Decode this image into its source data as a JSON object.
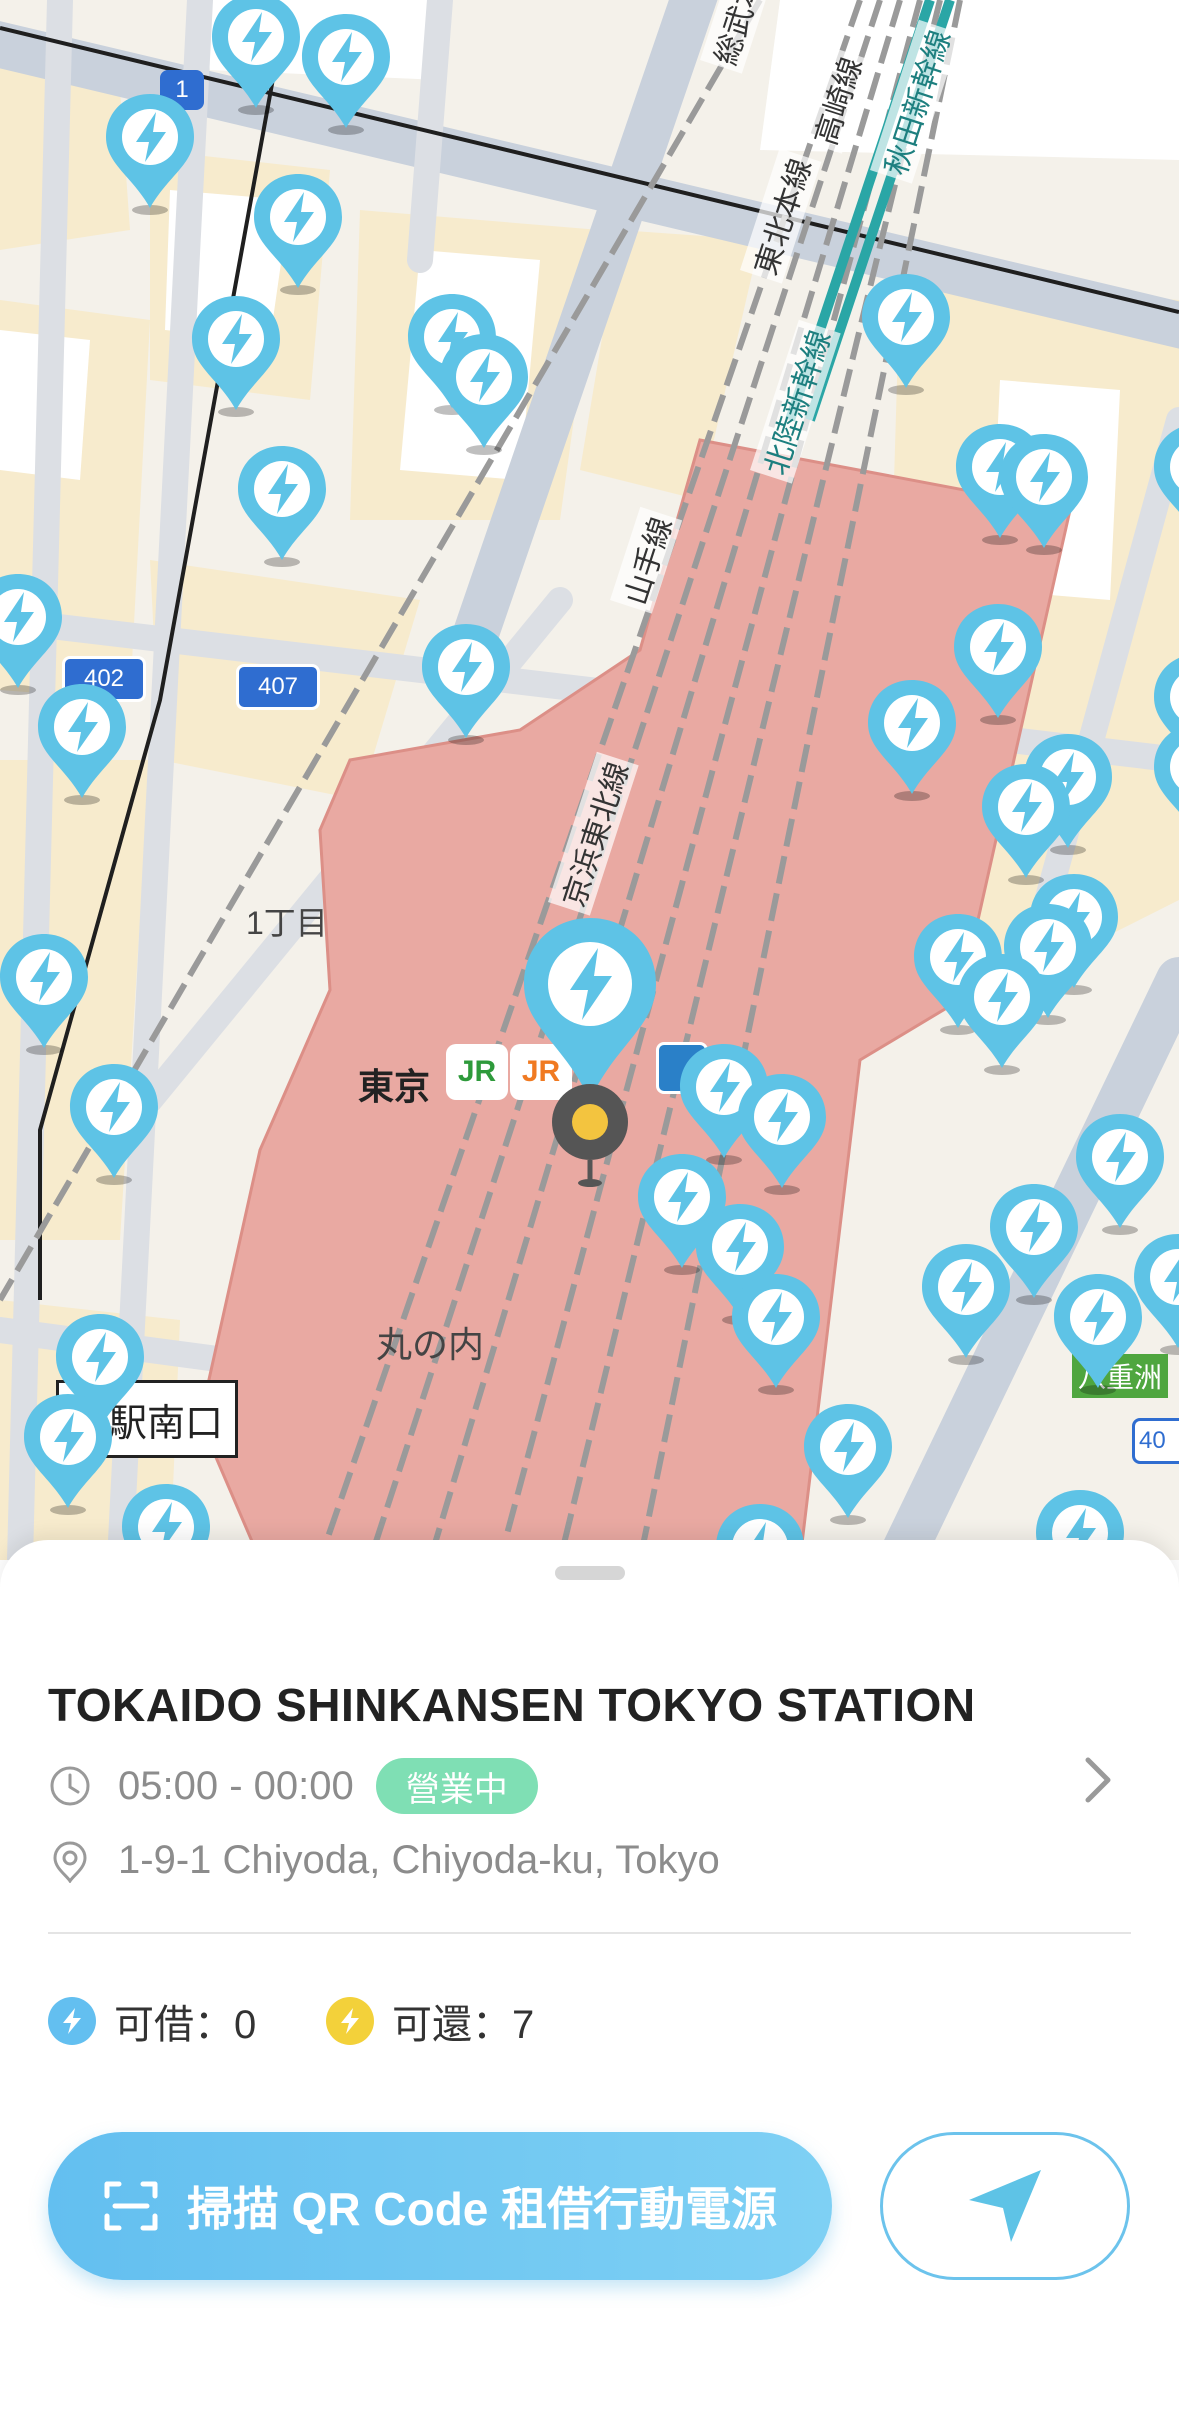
{
  "map": {
    "road_badges": [
      "1",
      "402",
      "407",
      "40"
    ],
    "rail_labels": [
      "総武本線",
      "東北本線",
      "高崎線",
      "秋田新幹線",
      "北陸新幹線",
      "山手線",
      "京浜東北線"
    ],
    "area_labels": [
      "1丁目",
      "丸の内",
      "八重洲"
    ],
    "station_name": "東京",
    "station_logos": [
      "JR",
      "JR"
    ],
    "exit_label": "京駅南口",
    "colors": {
      "station_area": "#e9a9a2",
      "pin": "#5ec3e6",
      "current_location": "#f3c43f"
    }
  },
  "station": {
    "name": "TOKAIDO SHINKANSEN TOKYO STATION",
    "hours": "05:00 - 00:00",
    "status_badge": "營業中",
    "address": "1-9-1 Chiyoda, Chiyoda-ku, Tokyo"
  },
  "availability": {
    "rent": {
      "label": "可借：0",
      "icon": "bolt-blue-icon"
    },
    "return": {
      "label": "可還：7",
      "icon": "bolt-yellow-icon"
    }
  },
  "actions": {
    "scan_label": "掃描 QR Code 租借行動電源",
    "navigate_icon": "navigate-arrow-icon"
  }
}
